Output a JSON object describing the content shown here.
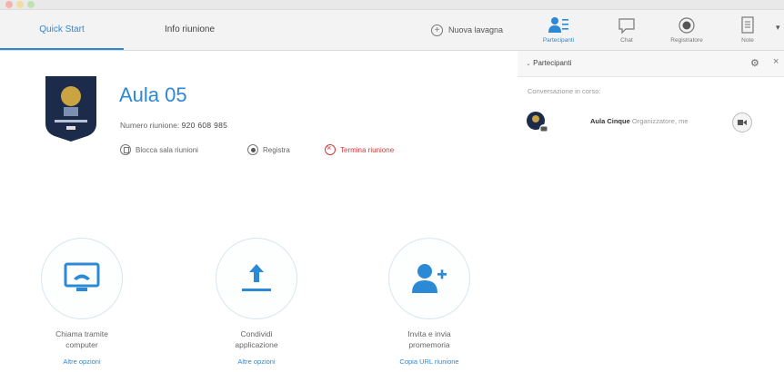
{
  "tabs": {
    "quick_start": "Quick Start",
    "info_riunione": "Info riunione"
  },
  "toolbar": {
    "new_layout": "Nuova lavagna",
    "partecipanti": "Partecipanti",
    "chat": "Chat",
    "registratore": "Registratore",
    "note": "Note"
  },
  "meeting": {
    "title": "Aula 05",
    "number_label": "Numero riunione:",
    "number_value": "920 608 985",
    "lock": "Blocca sala riunioni",
    "record": "Registra",
    "end": "Termina riunione"
  },
  "tiles": [
    {
      "line1": "Chiama tramite",
      "line2": "computer",
      "link": "Altre opzioni"
    },
    {
      "line1": "Condividi",
      "line2": "applicazione",
      "link": "Altre opzioni"
    },
    {
      "line1": "Invita e invia",
      "line2": "promemoria",
      "link": "Copia URL riunione"
    }
  ],
  "panel": {
    "title": "Partecipanti",
    "section": "Conversazione in corso:",
    "participants": [
      {
        "name": "Aula Cinque",
        "role": "Organizzatore, me"
      }
    ]
  },
  "colors": {
    "accent": "#2b89d6",
    "danger": "#d23a3a"
  }
}
